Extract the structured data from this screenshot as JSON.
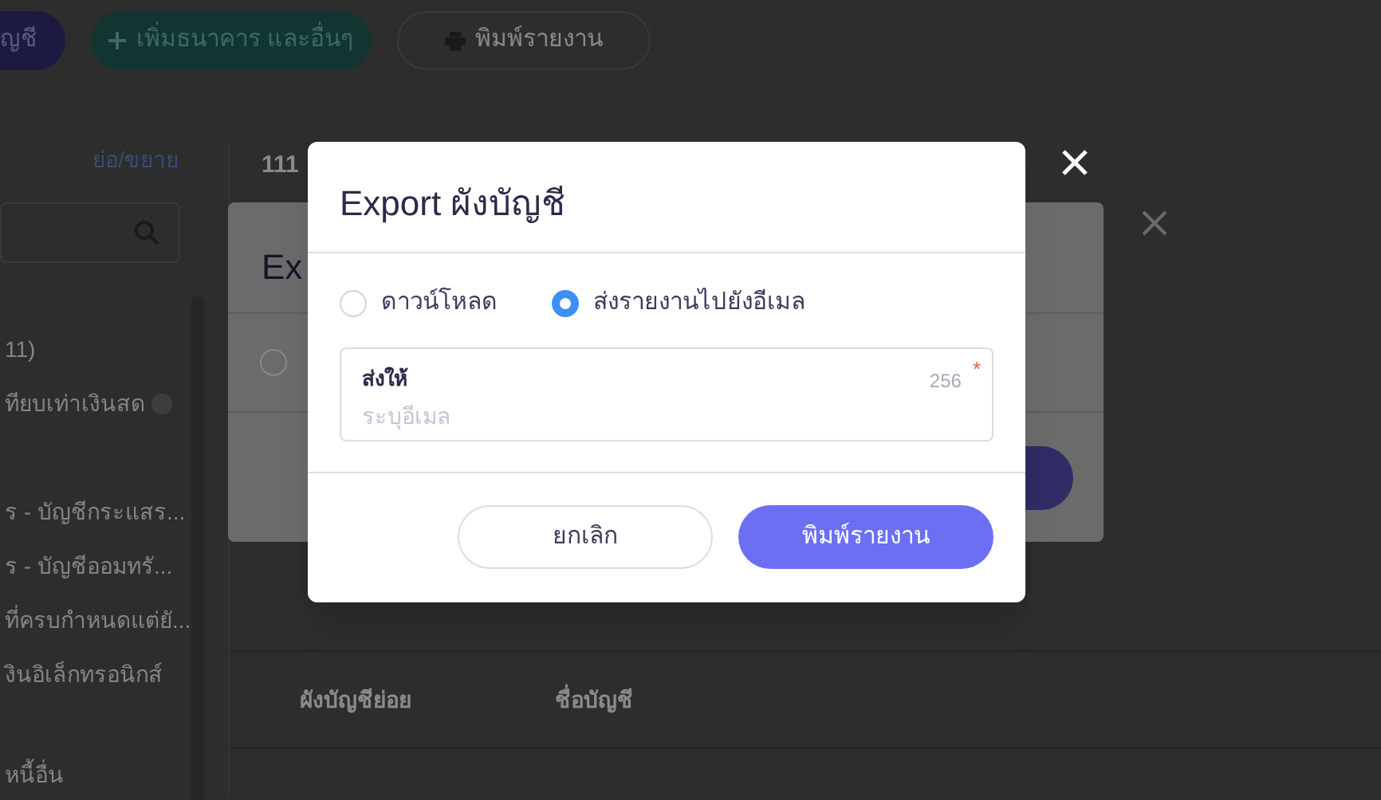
{
  "toolbar": {
    "buttons": [
      {
        "label": "ญชี",
        "kind": "primary"
      },
      {
        "label": "เพิ่มธนาคาร และอื่นๆ",
        "kind": "add"
      },
      {
        "label": "พิมพ์รายงาน",
        "kind": "print"
      }
    ]
  },
  "sidebar": {
    "toggle": "ย่อ/ขยาย",
    "items": [
      {
        "label": "11)",
        "kind": "text"
      },
      {
        "label": "ทียบเท่าเงินสด",
        "kind": "info"
      },
      {
        "label": "ร - บัญชีกระแสร...",
        "kind": "text"
      },
      {
        "label": "ร - บัญชีออมทรั...",
        "kind": "text"
      },
      {
        "label": "ที่ครบกำหนดแต่ยั...",
        "kind": "text"
      },
      {
        "label": "งินอิเล็กทรอนิกส์",
        "kind": "text"
      },
      {
        "label": "หนี้อื่น",
        "kind": "text"
      }
    ]
  },
  "main": {
    "code": "111",
    "table": {
      "columns": [
        "ผังบัญชีย่อย",
        "ชื่อบัญชี"
      ]
    }
  },
  "background_dialog": {
    "title": "Ex",
    "options": [
      {
        "selected": false
      }
    ]
  },
  "dialog": {
    "title": "Export ผังบัญชี",
    "options": [
      {
        "label": "ดาวน์โหลด",
        "selected": false
      },
      {
        "label": "ส่งรายงานไปยังอีเมล",
        "selected": true
      }
    ],
    "field": {
      "label": "ส่งให้",
      "counter": "256",
      "required_mark": "*",
      "placeholder": "ระบุอีเมล"
    },
    "buttons": [
      {
        "label": "ยกเลิก",
        "kind": "secondary"
      },
      {
        "label": "พิมพ์รายงาน",
        "kind": "primary"
      }
    ]
  }
}
